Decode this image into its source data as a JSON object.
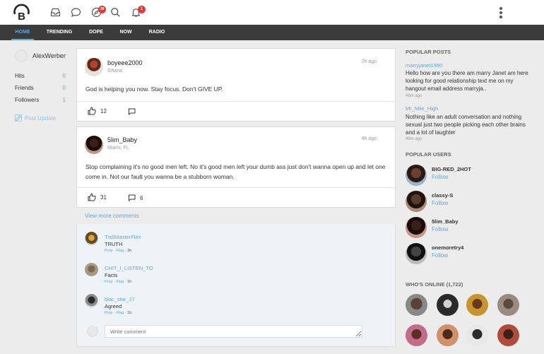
{
  "header": {
    "logo_letter": "B",
    "messages_badge": "28",
    "notifications_badge": "1"
  },
  "nav": {
    "items": [
      {
        "label": "HOME",
        "active": true
      },
      {
        "label": "TRENDING",
        "active": false
      },
      {
        "label": "DOPE",
        "active": false
      },
      {
        "label": "NOW",
        "active": false
      },
      {
        "label": "RADIO",
        "active": false
      }
    ]
  },
  "sidebar": {
    "username": "AlexWerber",
    "stats": [
      {
        "label": "Hits",
        "value": "0"
      },
      {
        "label": "Friends",
        "value": "0"
      },
      {
        "label": "Followers",
        "value": "1"
      }
    ],
    "post_update_label": "Post Update"
  },
  "posts": [
    {
      "author": "boyeee2000",
      "location": "Ghana",
      "time": "2h ago",
      "text": "God is helping you now. Stay focus. Don't GIVE UP.",
      "likes": "12",
      "comments": ""
    },
    {
      "author": "5lim_Baby",
      "location": "Miami, FL",
      "time": "4h ago",
      "text": "Stop complaining it's no good men left. No it's good men left your dumb ass just don't wanna open up and let one come in. Not our fault you wanna be a stubborn woman.",
      "likes": "31",
      "comments": "6"
    }
  ],
  "comments_section": {
    "view_more_label": "View more comments",
    "items": [
      {
        "user": "TrollMasterFlex",
        "text": "TRUTH",
        "prop": "Prop",
        "flag": "Flag",
        "time": "3h"
      },
      {
        "user": "CHIT_I_LISTEN_TO",
        "text": "Facts",
        "prop": "Prop",
        "flag": "Flag",
        "time": "1h"
      },
      {
        "user": "blac_star_27",
        "text": "Agreed",
        "prop": "Prop",
        "flag": "Flag",
        "time": "1h"
      }
    ],
    "write_placeholder": "Write comment"
  },
  "right": {
    "popular_posts_title": "POPULAR POSTS",
    "popular_posts": [
      {
        "user": "marryjanet1990",
        "text": "Hello how are you there am marry Janet am here looking for good relationship text me on my hangout email address marryja..",
        "time": "46m ago"
      },
      {
        "user": "Mr_Mile_High",
        "text": "Nothing like an adult conversation and nothing sexual just two people picking each other brains and a lot of laughter",
        "time": "49m ago"
      }
    ],
    "popular_users_title": "POPULAR USERS",
    "popular_users": [
      {
        "name": "BIG-RED_2HOT",
        "follow": "Follow"
      },
      {
        "name": "classy-S",
        "follow": "Follow"
      },
      {
        "name": "5lim_Baby",
        "follow": "Follow"
      },
      {
        "name": "onemoretry4",
        "follow": "Follow"
      }
    ],
    "online_title": "WHO'S ONLINE (1,722)"
  },
  "colors": {
    "accent": "#5aa8e6",
    "nav_bg": "#3b3b3b",
    "badge": "#e03a3a"
  }
}
